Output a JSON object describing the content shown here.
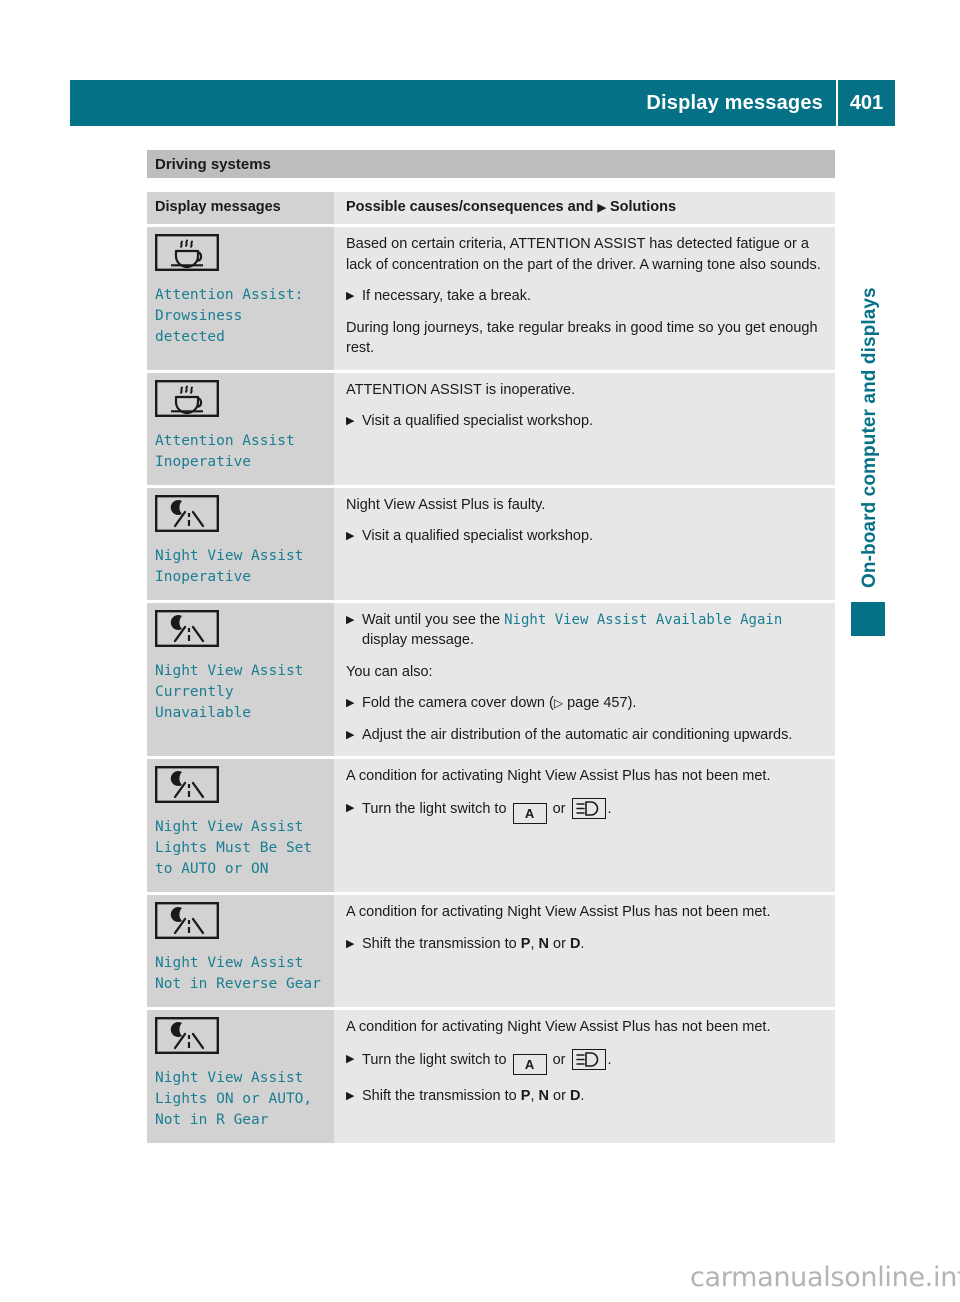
{
  "header": {
    "title": "Display messages",
    "page_number": "401",
    "accent_color": "#057186"
  },
  "side_tab": {
    "label": "On-board computer and displays",
    "marker_color": "#057186"
  },
  "section": {
    "heading": "Driving systems"
  },
  "table": {
    "columns": {
      "left": "Display messages",
      "right_prefix": "Possible causes/consequences and",
      "right_bullet": "▶",
      "right_suffix": "Solutions"
    },
    "rows": [
      {
        "icon": "coffee-cup-icon",
        "message": "Attention Assist:\nDrowsiness\ndetected",
        "content": [
          {
            "kind": "para",
            "text": "Based on certain criteria, ATTENTION ASSIST has detected fatigue or a lack of concentration on the part of the driver. A warning tone also sounds."
          },
          {
            "kind": "bullet",
            "text": "If necessary, take a break."
          },
          {
            "kind": "para",
            "text": "During long journeys, take regular breaks in good time so you get enough rest."
          }
        ]
      },
      {
        "icon": "coffee-cup-icon",
        "message": "Attention Assist\nInoperative",
        "content": [
          {
            "kind": "para",
            "text": "ATTENTION ASSIST is inoperative."
          },
          {
            "kind": "bullet",
            "text": "Visit a qualified specialist workshop."
          }
        ]
      },
      {
        "icon": "night-view-assist-icon",
        "message": "Night View Assist\nInoperative",
        "content": [
          {
            "kind": "para",
            "text": "Night View Assist Plus is faulty."
          },
          {
            "kind": "bullet",
            "text": "Visit a qualified specialist workshop."
          }
        ]
      },
      {
        "icon": "night-view-assist-icon",
        "message": "Night View Assist\nCurrently\nUnavailable",
        "content": [
          {
            "kind": "bullet-rich",
            "id": "wait-until",
            "pre": "Wait until you see the ",
            "highlight": "Night View Assist Available Again",
            "post": " display message."
          },
          {
            "kind": "para",
            "text": "You can also:"
          },
          {
            "kind": "bullet-ref",
            "id": "fold-camera",
            "pre": "Fold the camera cover down (",
            "ref_arrow": "▷",
            "ref_text": " page 457",
            "post": ")."
          },
          {
            "kind": "bullet",
            "text": "Adjust the air distribution of the automatic air conditioning upwards."
          }
        ]
      },
      {
        "icon": "night-view-assist-icon",
        "message": "Night View Assist\nLights Must Be Set\nto AUTO or ON",
        "content": [
          {
            "kind": "para",
            "text": "A condition for activating Night View Assist Plus has not been met."
          },
          {
            "kind": "bullet-lights",
            "id": "light-switch",
            "pre": "Turn the light switch to ",
            "auto_label": "A",
            "mid": " or ",
            "post": "."
          }
        ]
      },
      {
        "icon": "night-view-assist-icon",
        "message": "Night View Assist\nNot in Reverse Gear",
        "content": [
          {
            "kind": "para",
            "text": "A condition for activating Night View Assist Plus has not been met."
          },
          {
            "kind": "bullet-gears",
            "id": "shift-transmission",
            "pre": "Shift the transmission to ",
            "gear_p": "P",
            "sep1": ", ",
            "gear_n": "N",
            "sep2": " or ",
            "gear_d": "D",
            "post": "."
          }
        ]
      },
      {
        "icon": "night-view-assist-icon",
        "message": "Night View Assist\nLights ON or AUTO,\nNot in R Gear",
        "content": [
          {
            "kind": "para",
            "text": "A condition for activating Night View Assist Plus has not been met."
          },
          {
            "kind": "bullet-lights",
            "id": "light-switch-2",
            "pre": "Turn the light switch to ",
            "auto_label": "A",
            "mid": " or ",
            "post": "."
          },
          {
            "kind": "bullet-gears",
            "id": "shift-transmission-2",
            "pre": "Shift the transmission to ",
            "gear_p": "P",
            "sep1": ", ",
            "gear_n": "N",
            "sep2": " or ",
            "gear_d": "D",
            "post": "."
          }
        ]
      }
    ]
  },
  "watermark": "carmanualsonline.info"
}
